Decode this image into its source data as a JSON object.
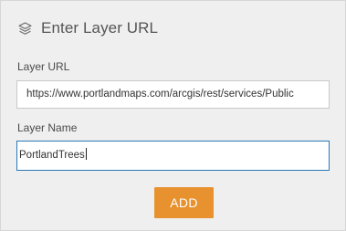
{
  "header": {
    "icon": "layers-icon",
    "title": "Enter Layer URL"
  },
  "form": {
    "url_label": "Layer URL",
    "url_value": "https://www.portlandmaps.com/arcgis/rest/services/Public",
    "name_label": "Layer Name",
    "name_value": "PortlandTrees",
    "add_label": "ADD"
  },
  "colors": {
    "accent": "#e8912f",
    "focus_border": "#2b78b5",
    "panel_bg": "#efefef"
  }
}
